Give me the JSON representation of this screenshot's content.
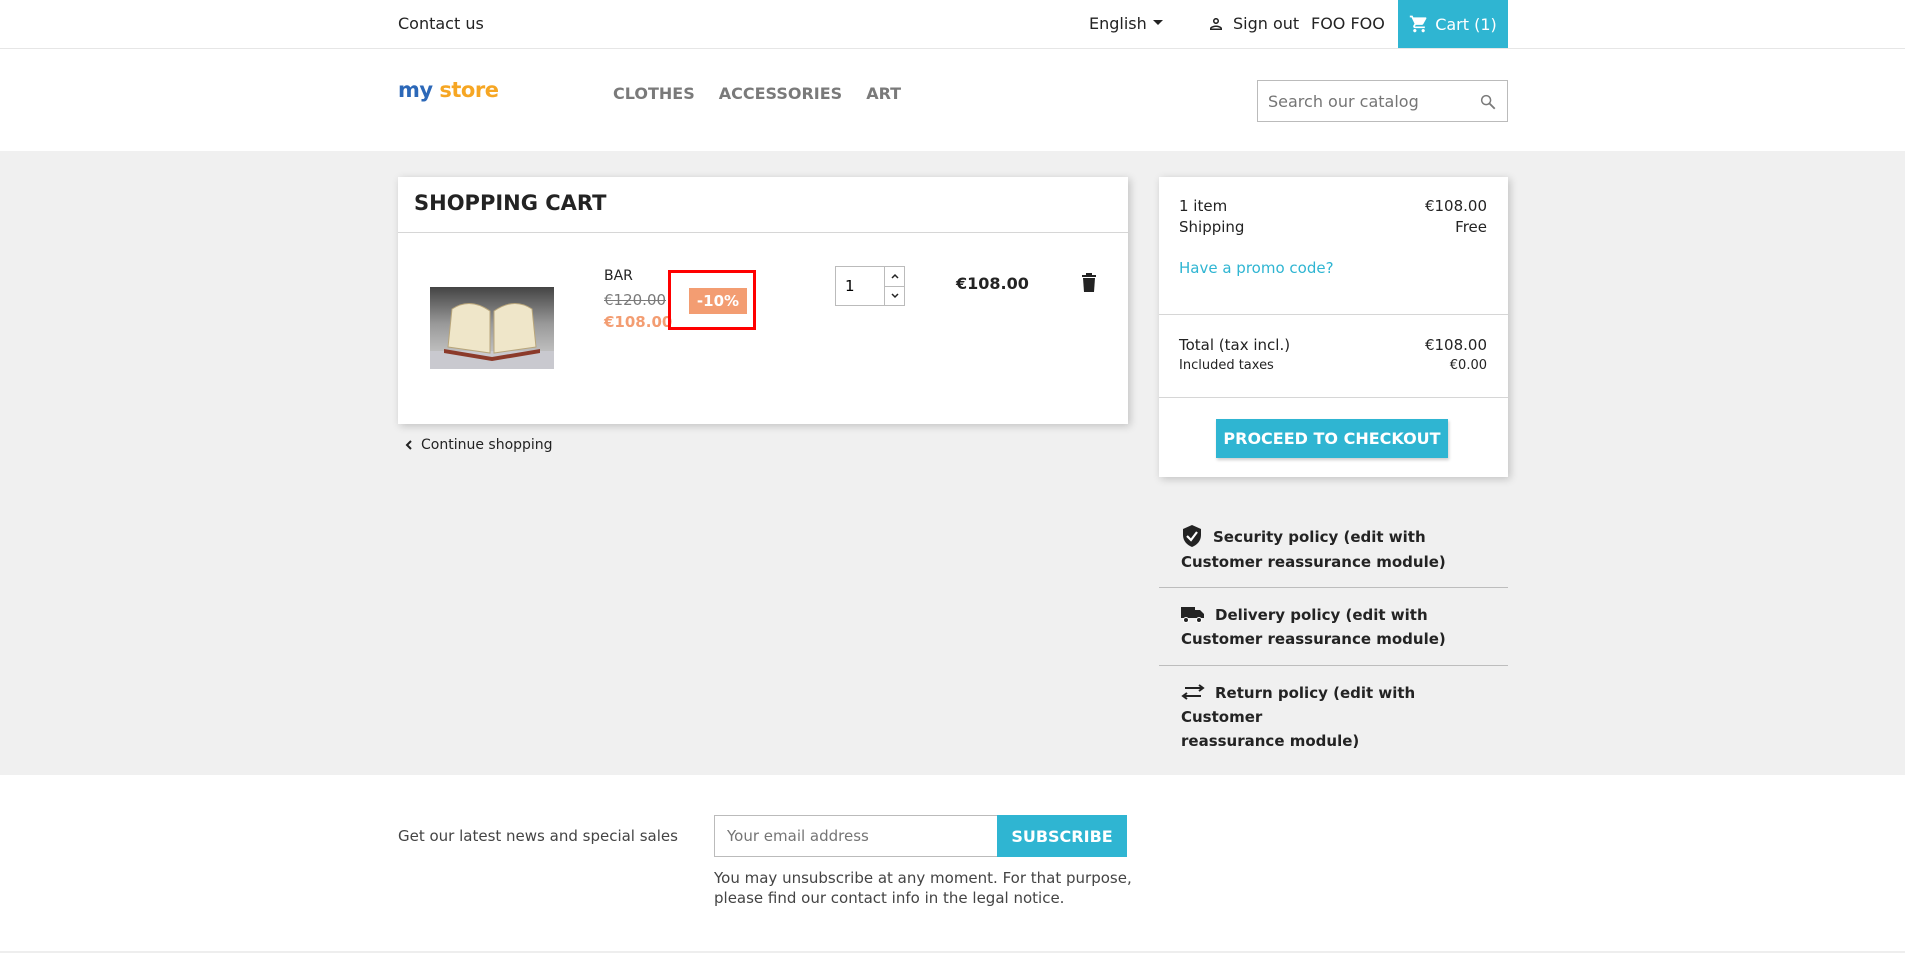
{
  "topbar": {
    "contact": "Contact us",
    "language": "English",
    "sign_out": "Sign out",
    "username": "FOO FOO",
    "cart": "Cart (1)"
  },
  "header": {
    "logo": {
      "my": "my",
      "store": "store"
    },
    "menu": [
      "CLOTHES",
      "ACCESSORIES",
      "ART"
    ],
    "search_placeholder": "Search our catalog"
  },
  "cart": {
    "title": "SHOPPING CART",
    "item": {
      "name": "BAR",
      "old_price": "€120.00",
      "new_price": "€108.00",
      "discount": "-10%",
      "quantity": "1",
      "total": "€108.00"
    },
    "continue": "Continue shopping"
  },
  "summary": {
    "items_label": "1 item",
    "items_value": "€108.00",
    "shipping_label": "Shipping",
    "shipping_value": "Free",
    "promo": "Have a promo code?",
    "total_label": "Total (tax incl.)",
    "total_value": "€108.00",
    "taxes_label": "Included taxes",
    "taxes_value": "€0.00",
    "checkout": "PROCEED TO CHECKOUT"
  },
  "reassurance": [
    {
      "icon": "shield-check-icon",
      "line1": "Security policy (edit with",
      "line2": "Customer reassurance module)"
    },
    {
      "icon": "truck-icon",
      "line1": "Delivery policy (edit with",
      "line2": "Customer reassurance module)"
    },
    {
      "icon": "swap-arrows-icon",
      "line1": "Return policy (edit with Customer",
      "line2": "reassurance module)"
    }
  ],
  "newsletter": {
    "text": "Get our latest news and special sales",
    "email_placeholder": "Your email address",
    "subscribe": "SUBSCRIBE",
    "unsubscribe_line1": "You may unsubscribe at any moment. For that purpose,",
    "unsubscribe_line2": "please find our contact info in the legal notice."
  },
  "colors": {
    "accent": "#2fb5d2",
    "discount": "#f39d72",
    "highlight": "#ff0000"
  }
}
